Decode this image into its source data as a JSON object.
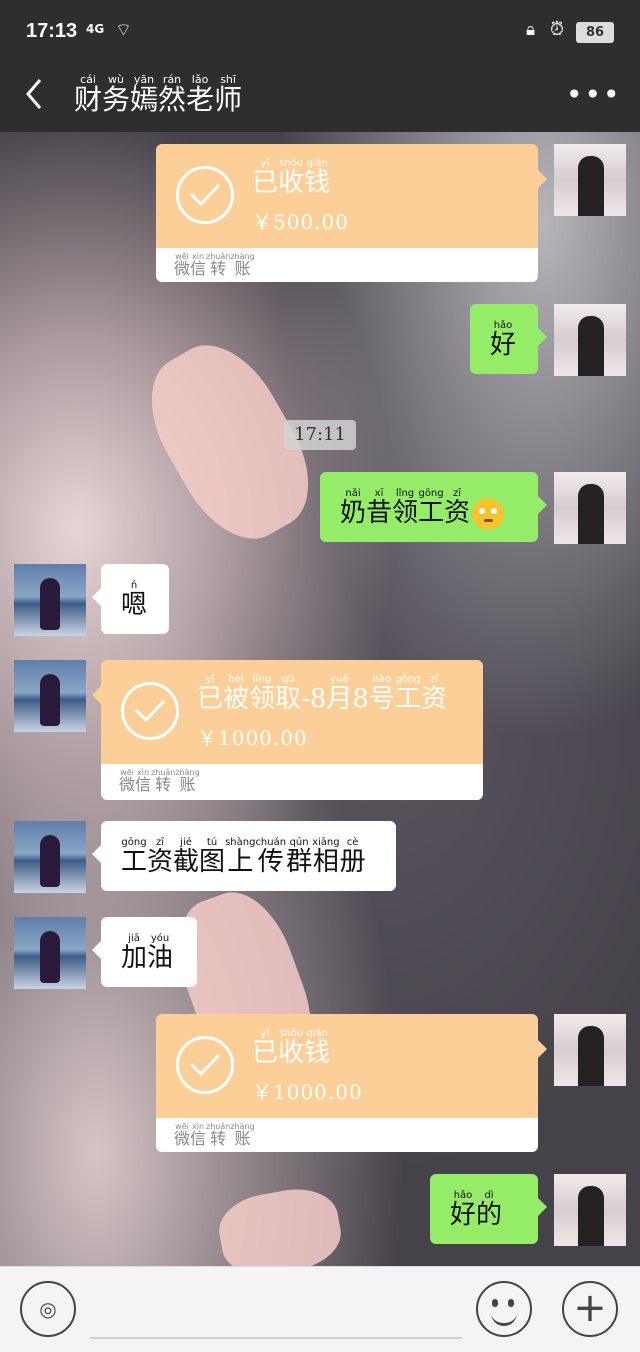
{
  "status_bar": {
    "time": "17:13",
    "signal": "4G",
    "battery": "86"
  },
  "header": {
    "title": [
      {
        "py": "cái",
        "hz": "财"
      },
      {
        "py": "wù",
        "hz": "务"
      },
      {
        "py": "yān",
        "hz": "嫣"
      },
      {
        "py": "rán",
        "hz": "然"
      },
      {
        "py": "lǎo",
        "hz": "老"
      },
      {
        "py": "shī",
        "hz": "师"
      }
    ]
  },
  "messages": {
    "m1": {
      "status": [
        {
          "py": "yǐ",
          "hz": "已"
        },
        {
          "py": "shōu",
          "hz": "收"
        },
        {
          "py": "qián",
          "hz": "钱"
        }
      ],
      "amount": "￥500.00",
      "footer": [
        {
          "py": "wēi",
          "hz": "微"
        },
        {
          "py": "xìn",
          "hz": "信"
        },
        {
          "py": "zhuǎn",
          "hz": "转"
        },
        {
          "py": "zhàng",
          "hz": "账"
        }
      ]
    },
    "m2": {
      "text": [
        {
          "py": "hǎo",
          "hz": "好"
        }
      ]
    },
    "timestamp": "17:11",
    "m3": {
      "text": [
        {
          "py": "nǎi",
          "hz": "奶"
        },
        {
          "py": "xī",
          "hz": "昔"
        },
        {
          "py": "lǐng",
          "hz": "领"
        },
        {
          "py": "gōng",
          "hz": "工"
        },
        {
          "py": "zī",
          "hz": "资"
        }
      ]
    },
    "m4": {
      "text": [
        {
          "py": "ń",
          "hz": "嗯"
        }
      ]
    },
    "m5": {
      "status": [
        {
          "py": "yǐ",
          "hz": "已"
        },
        {
          "py": "bèi",
          "hz": "被"
        },
        {
          "py": "lǐng",
          "hz": "领"
        },
        {
          "py": "qǔ",
          "hz": "取"
        },
        {
          "py": "",
          "hz": "-8"
        },
        {
          "py": "yuè",
          "hz": "月"
        },
        {
          "py": "",
          "hz": "8"
        },
        {
          "py": "hào",
          "hz": "号"
        },
        {
          "py": "gōng",
          "hz": "工"
        },
        {
          "py": "zī",
          "hz": "资"
        }
      ],
      "amount": "￥1000.00",
      "footer": [
        {
          "py": "wēi",
          "hz": "微"
        },
        {
          "py": "xìn",
          "hz": "信"
        },
        {
          "py": "zhuǎn",
          "hz": "转"
        },
        {
          "py": "zhàng",
          "hz": "账"
        }
      ]
    },
    "m6": {
      "text": [
        {
          "py": "gōng",
          "hz": "工"
        },
        {
          "py": "zī",
          "hz": "资"
        },
        {
          "py": "jié",
          "hz": "截"
        },
        {
          "py": "tú",
          "hz": "图"
        },
        {
          "py": "shàng",
          "hz": "上"
        },
        {
          "py": "chuán",
          "hz": "传"
        },
        {
          "py": "qún",
          "hz": "群"
        },
        {
          "py": "xiāng",
          "hz": "相"
        },
        {
          "py": "cè",
          "hz": "册"
        }
      ]
    },
    "m7": {
      "text": [
        {
          "py": "jiā",
          "hz": "加"
        },
        {
          "py": "yóu",
          "hz": "油"
        }
      ]
    },
    "m8": {
      "status": [
        {
          "py": "yǐ",
          "hz": "已"
        },
        {
          "py": "shōu",
          "hz": "收"
        },
        {
          "py": "qián",
          "hz": "钱"
        }
      ],
      "amount": "￥1000.00",
      "footer": [
        {
          "py": "wēi",
          "hz": "微"
        },
        {
          "py": "xìn",
          "hz": "信"
        },
        {
          "py": "zhuǎn",
          "hz": "转"
        },
        {
          "py": "zhàng",
          "hz": "账"
        }
      ]
    },
    "m9": {
      "text": [
        {
          "py": "hǎo",
          "hz": "好"
        },
        {
          "py": "dì",
          "hz": "的"
        }
      ]
    }
  },
  "colors": {
    "header_bg": "#2e2e2e",
    "green_bubble": "#95ec69",
    "transfer_orange": "#fccf98",
    "white_bubble": "#ffffff"
  },
  "icons": {
    "back": "chevron-left-icon",
    "more": "more-dots-icon",
    "voice": "voice-icon",
    "emoji": "emoji-icon",
    "plus": "plus-icon",
    "check": "check-circle-icon"
  }
}
